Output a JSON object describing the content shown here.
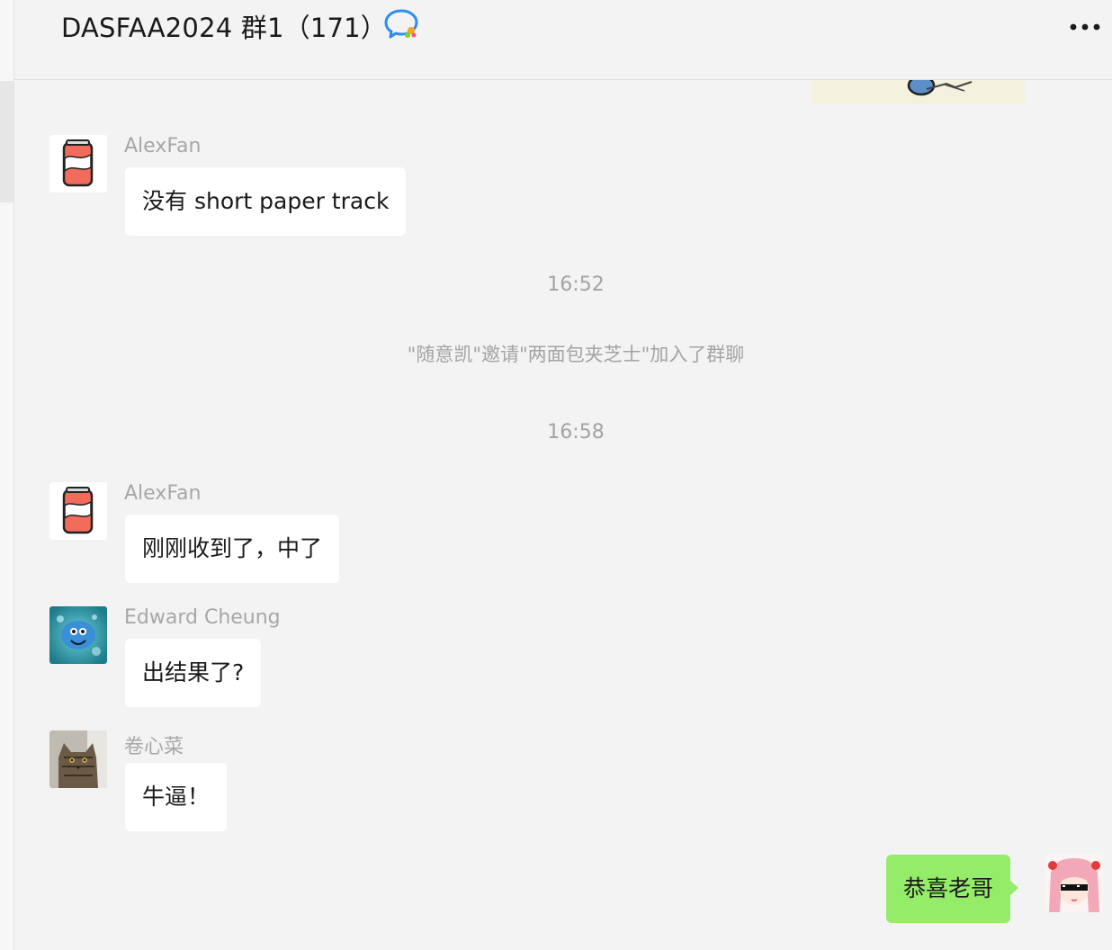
{
  "chat": {
    "title": "DASFAA2024 群1（171）"
  },
  "messages": [
    {
      "sender": "AlexFan",
      "text": "没有 short paper track"
    },
    {
      "timestamp": "16:52"
    },
    {
      "system": "\"随意凯\"邀请\"两面包夹芝士\"加入了群聊"
    },
    {
      "timestamp": "16:58"
    },
    {
      "sender": "AlexFan",
      "text": "刚刚收到了，中了"
    },
    {
      "sender": "Edward Cheung",
      "text": "出结果了?"
    },
    {
      "sender": "卷心菜",
      "text": "牛逼！"
    },
    {
      "sender": "",
      "text": "恭喜老哥",
      "self": true
    }
  ],
  "icons": {
    "group": "group-chat-icon",
    "more": "more-dots-icon",
    "avatar_alexfan": "soda-can-avatar",
    "avatar_edward": "blue-creature-avatar",
    "avatar_cabbage": "cat-avatar",
    "avatar_self": "anime-girl-avatar"
  },
  "colors": {
    "background": "#f3f3f3",
    "bubble_other": "#ffffff",
    "bubble_self": "#95ec69",
    "meta_text": "#a3a3a3"
  }
}
